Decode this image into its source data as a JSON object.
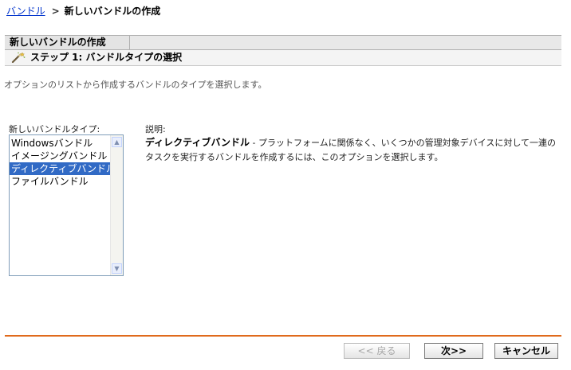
{
  "breadcrumb": {
    "parent": "バンドル",
    "separator": ">",
    "current": "新しいバンドルの作成"
  },
  "header": {
    "title": "新しいバンドルの作成",
    "step": "ステップ 1: バンドルタイプの選択",
    "step_icon": "wizard-wand-icon"
  },
  "instruction": "オプションのリストから作成するバンドルのタイプを選択します。",
  "bundle_types": {
    "label": "新しいバンドルタイプ:",
    "items": [
      {
        "label": "Windowsバンドル"
      },
      {
        "label": "イメージングバンドル"
      },
      {
        "label": "ディレクティブバンドル"
      },
      {
        "label": "ファイルバンドル"
      }
    ],
    "selected_index": 2
  },
  "description": {
    "label": "説明:",
    "title": "ディレクティブバンドル",
    "text": " - プラットフォームに関係なく、いくつかの管理対象デバイスに対して一連のタスクを実行するバンドルを作成するには、このオプションを選択します。"
  },
  "buttons": {
    "back": "<< 戻る",
    "next": "次>>",
    "cancel": "キャンセル"
  },
  "colors": {
    "link": "#0033cc",
    "selection": "#316ac5",
    "divider": "#e06a1c"
  }
}
